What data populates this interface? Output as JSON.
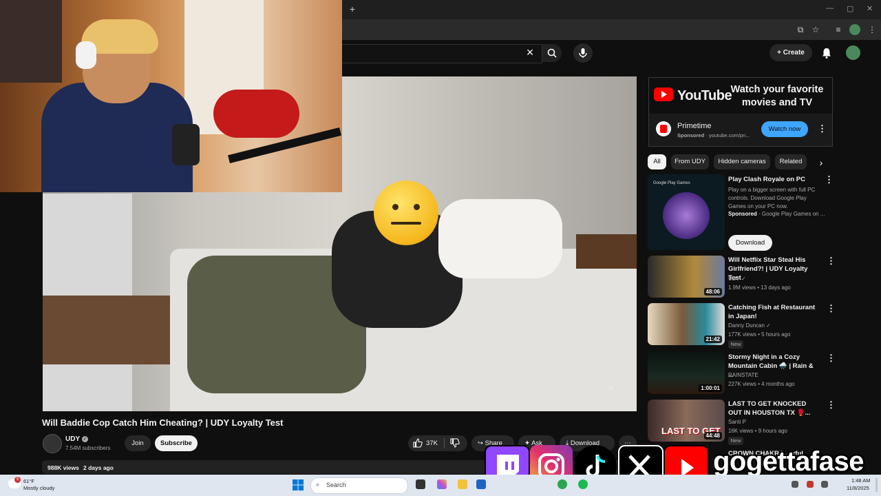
{
  "search": {
    "placeholder": ""
  },
  "header": {
    "create_label": "Create"
  },
  "video": {
    "title": "Will Baddie Cop Catch Him Cheating? | UDY Loyalty Test",
    "channel": "UDY",
    "subscribers": "7.54M subscribers",
    "join_label": "Join",
    "subscribe_label": "Subscribe",
    "likes": "37K",
    "share_label": "Share",
    "ask_label": "Ask",
    "download_label": "Download",
    "views": "988K views",
    "age": "2 days ago"
  },
  "ad": {
    "youtube_wordmark": "YouTube",
    "headline": "Watch your favorite movies and TV",
    "advertiser": "Primetime",
    "sponsored": "Sponsored",
    "domain": "youtube.com/pri...",
    "cta": "Watch now"
  },
  "chips": [
    "All",
    "From UDY",
    "Hidden cameras",
    "Related"
  ],
  "related": [
    {
      "title": "Play Clash Royale on PC",
      "desc": "Play on a bigger screen with full PC controls. Download Google Play Games on your PC now.",
      "sponsored": "Sponsored",
      "advertiser": "· Google Play Games on ...",
      "badge": "Google Play Games",
      "cta": "Download"
    },
    {
      "title": "Will Netflix Star Steal His Girlfriend?! | UDY Loyalty Test",
      "channel": "UDY",
      "meta": "1.9M views • 13 days ago",
      "duration": "48:06"
    },
    {
      "title": "Catching Fish at Restaurant in Japan!",
      "channel": "Danny Duncan",
      "meta": "177K views • 5 hours ago",
      "duration": "21:42",
      "new": "New"
    },
    {
      "title": "Stormy Night in a Cozy Mountain Cabin 🌧️ | Rain & ...",
      "channel": "RAINSTATE",
      "meta": "227K views • 4 months ago",
      "duration": "1:00:01"
    },
    {
      "title": "LAST TO GET KNOCKED OUT IN HOUSTON TX 🥊...",
      "channel": "Santi P",
      "meta": "16K views • 9 hours ago",
      "duration": "44:48",
      "new": "New",
      "thumb_text": "LAST TO GET"
    },
    {
      "title": "CROWN CHAKRA ... rful"
    }
  ],
  "overlay": {
    "brand": "gogettafase"
  },
  "taskbar": {
    "temp": "61°F",
    "weather": "Mostly cloudy",
    "weather_badge": "5",
    "search_label": "Search",
    "time": "1:48 AM",
    "date": "11/8/2025"
  },
  "colors": {
    "youtube_red": "#ff0000",
    "accent_blue": "#3ea6ff",
    "twitch_purple": "#9146ff"
  }
}
